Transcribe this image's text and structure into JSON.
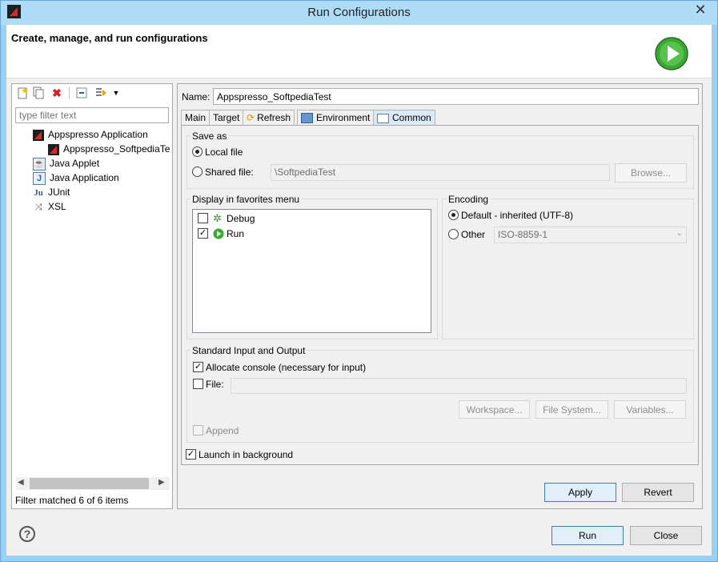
{
  "window": {
    "title": "Run Configurations",
    "close_glyph": "✕"
  },
  "banner": {
    "title": "Create, manage, and run configurations"
  },
  "left": {
    "filter_placeholder": "type filter text",
    "tree": [
      {
        "label": "Appspresso Application",
        "icon": "appspresso-icon"
      },
      {
        "label": "Appspresso_SoftpediaTe",
        "icon": "appspresso-icon"
      },
      {
        "label": "Java Applet",
        "icon": "java-applet-icon"
      },
      {
        "label": "Java Application",
        "icon": "java-application-icon"
      },
      {
        "label": "JUnit",
        "icon": "junit-icon"
      },
      {
        "label": "XSL",
        "icon": "xsl-icon"
      }
    ],
    "status": "Filter matched 6 of 6 items"
  },
  "right": {
    "name_label": "Name:",
    "name_value": "Appspresso_SoftpediaTest",
    "tabs": [
      "Main",
      "Target",
      "Refresh",
      "Environment",
      "Common"
    ],
    "active_tab": "Common",
    "save_as": {
      "title": "Save as",
      "local_label": "Local file",
      "shared_label": "Shared file:",
      "shared_value": "\\SoftpediaTest",
      "browse": "Browse..."
    },
    "favorites": {
      "title": "Display in favorites menu",
      "items": [
        {
          "label": "Debug",
          "checked": false,
          "icon": "debug-bug-icon"
        },
        {
          "label": "Run",
          "checked": true,
          "icon": "run-icon"
        }
      ]
    },
    "encoding": {
      "title": "Encoding",
      "default_label": "Default - inherited (UTF-8)",
      "other_label": "Other",
      "other_value": "ISO-8859-1"
    },
    "std_io": {
      "title": "Standard Input and Output",
      "allocate_label": "Allocate console (necessary for input)",
      "file_label": "File:",
      "workspace": "Workspace...",
      "filesystem": "File System...",
      "variables": "Variables...",
      "append_label": "Append"
    },
    "launch_bg_label": "Launch in background",
    "apply": "Apply",
    "revert": "Revert"
  },
  "footer": {
    "help": "?",
    "run": "Run",
    "close": "Close"
  },
  "colors": {
    "titlebar": "#aedbf6",
    "run_green": "#3aa832",
    "error_red": "#d92020"
  }
}
